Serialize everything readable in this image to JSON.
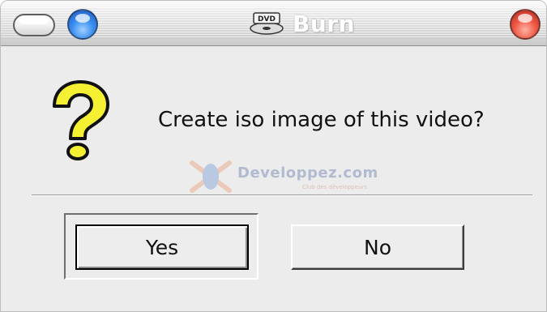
{
  "window": {
    "title": "Burn",
    "title_icon": "dvd-icon"
  },
  "dialog": {
    "message": "Create iso image of this video?",
    "icon": "question-icon"
  },
  "buttons": {
    "yes_label": "Yes",
    "no_label": "No"
  },
  "watermark": {
    "text": "Developpez.com",
    "subtext": "Club des développeurs"
  },
  "colors": {
    "minimize_orb": "#3a8ef0",
    "close_orb": "#f05a45",
    "question_fill": "#f5f032",
    "window_background": "#ececec"
  }
}
